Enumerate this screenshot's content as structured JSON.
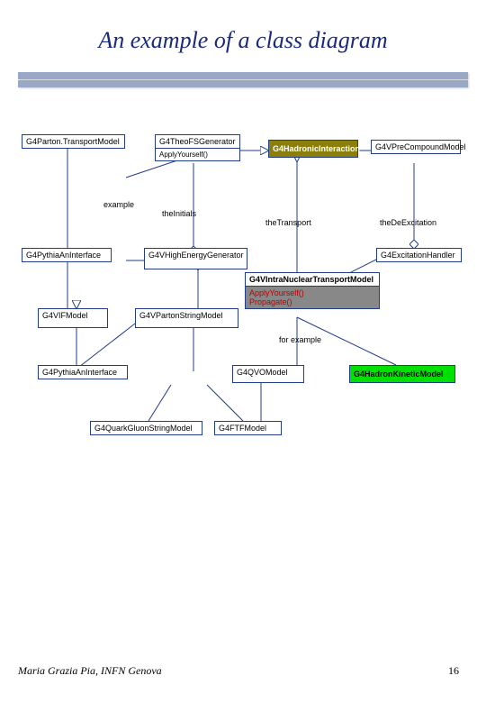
{
  "title": "An example of a class diagram",
  "boxes": {
    "parton_transport": "G4Parton.TransportModel",
    "theo_fs": "G4TheoFSGenerator",
    "theo_fs_method": "ApplyYourself()",
    "hadronic_interaction": "G4HadronicInteraction",
    "vpre_compound": "G4VPreCompoundModel",
    "pythia_a": "G4PythiaAnInterface",
    "vhigh_energy": "G4VHighEnergyGenerator",
    "excitation": "G4ExcitationHandler",
    "vintra_nuclear": "G4VIntraNuclearTransportModel",
    "vintra_m1": "ApplyYourself()",
    "vintra_m2": "Propagate()",
    "vif_model": "G4VIFModel",
    "vparton_string": "G4VPartonStringModel",
    "hadron_kinetic": "G4HadronKineticModel",
    "pythia_n": "G4PythiaAnInterface",
    "qvq_model": "G4QVOModel",
    "quark_gluon": "G4QuarkGluonStringModel",
    "ftf_model": "G4FTFModel"
  },
  "labels": {
    "example": "example",
    "initials": "theInitials",
    "transport": "theTransport",
    "deexcitation": "theDeExcitation",
    "for_example": "for example"
  },
  "footer_author": "Maria Grazia Pia, INFN Genova",
  "footer_page": "16"
}
